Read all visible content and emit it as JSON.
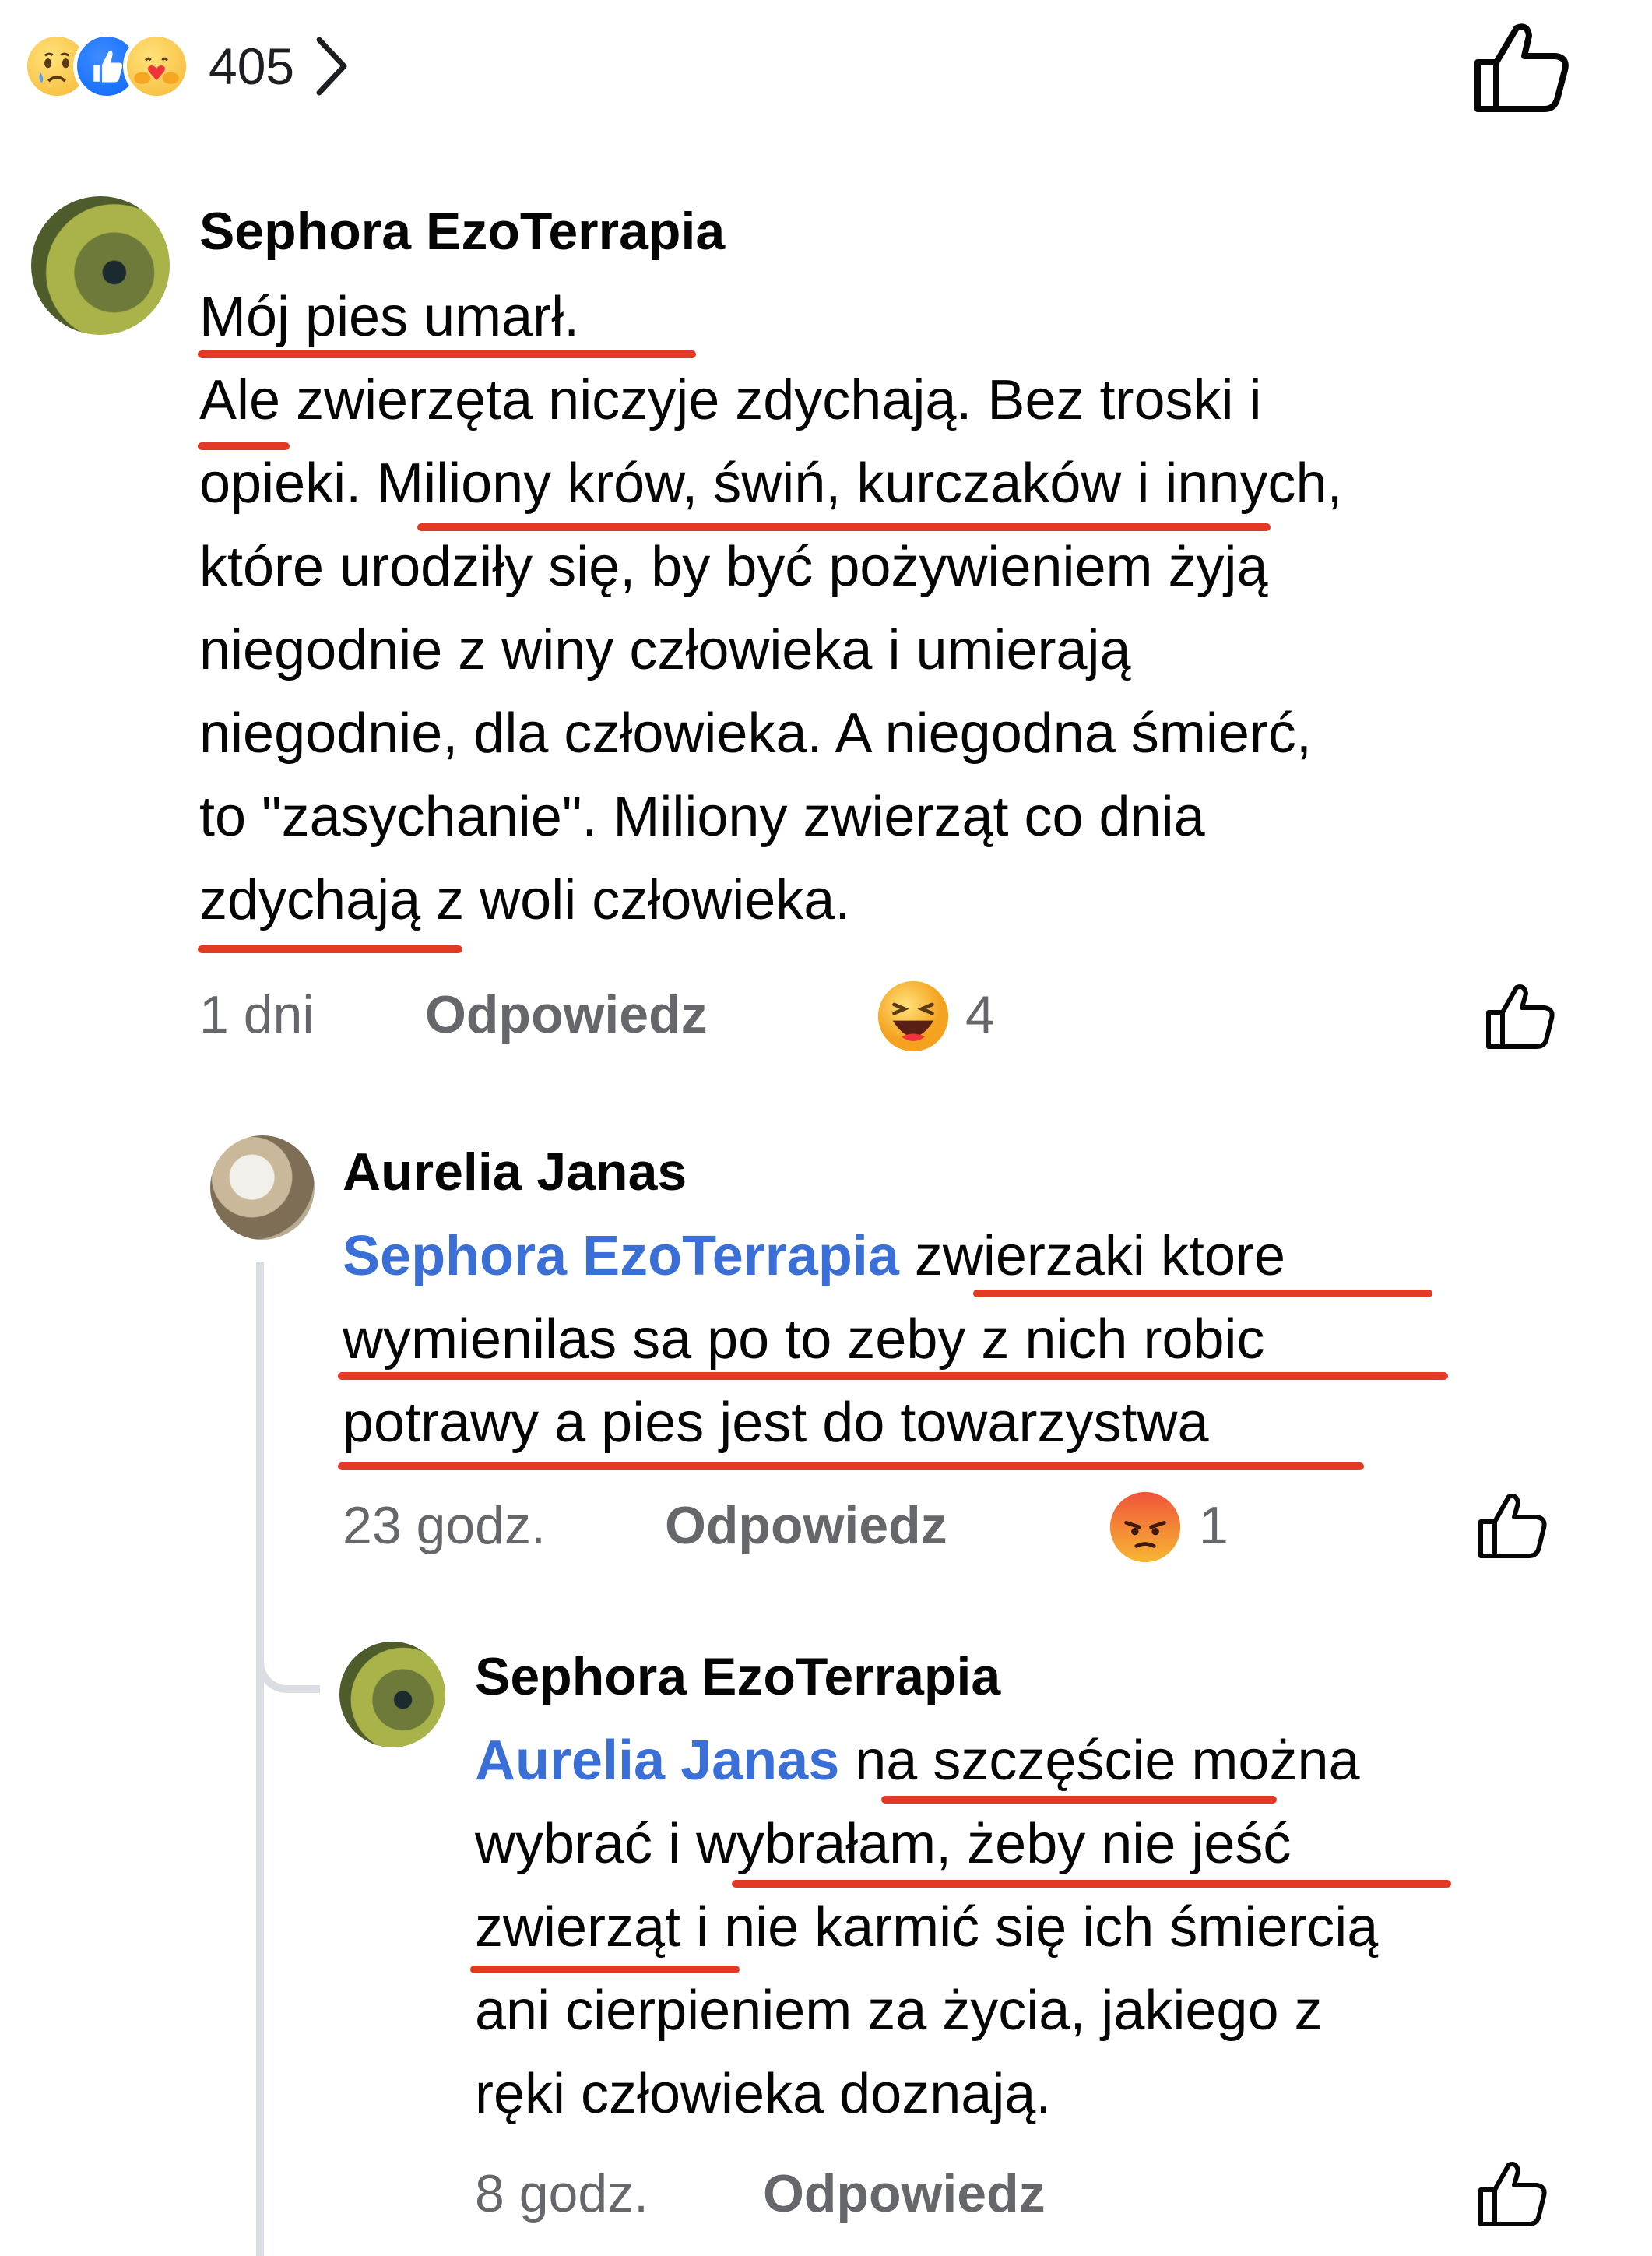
{
  "post": {
    "reaction_count": "405",
    "reaction_icons": [
      "sad-emoji-icon",
      "like-emoji-icon",
      "care-emoji-icon"
    ],
    "chevron": "›"
  },
  "comments": [
    {
      "author": "Sephora EzoTerrapia",
      "lines": [
        "Mój pies umarł.",
        "Ale zwierzęta niczyje zdychają. Bez troski i",
        "opieki. Miliony krów, świń, kurczaków i innych,",
        "które urodziły się, by być pożywieniem żyją",
        "niegodnie z winy człowieka i umierają",
        "niegodnie, dla człowieka. A niegodna śmierć,",
        "to \"zasychanie\". Miliony zwierząt co dnia",
        "zdychają z woli człowieka."
      ],
      "time": "1 dni",
      "reply_label": "Odpowiedz",
      "reaction_icon": "haha-emoji-icon",
      "reaction_count": "4"
    },
    {
      "author": "Aurelia Janas",
      "mention": "Sephora EzoTerrapia",
      "first_line_rest": " zwierzaki ktore",
      "lines": [
        "wymienilas sa po to zeby z nich robic",
        "potrawy a pies jest do towarzystwa"
      ],
      "time": "23 godz.",
      "reply_label": "Odpowiedz",
      "reaction_icon": "angry-emoji-icon",
      "reaction_count": "1"
    },
    {
      "author": "Sephora EzoTerrapia",
      "mention": "Aurelia Janas",
      "first_line_rest": " na szczęście można",
      "lines": [
        "wybrać i wybrałam, żeby nie jeść",
        "zwierząt i nie karmić się ich śmiercią",
        "ani cierpieniem za życia, jakiego z",
        "ręki człowieka doznają."
      ],
      "time": "8 godz.",
      "reply_label": "Odpowiedz"
    }
  ],
  "colors": {
    "mention": "#3a6fd8",
    "underline": "#e23a24",
    "meta": "#65676b",
    "thread_line": "#dadde1"
  }
}
